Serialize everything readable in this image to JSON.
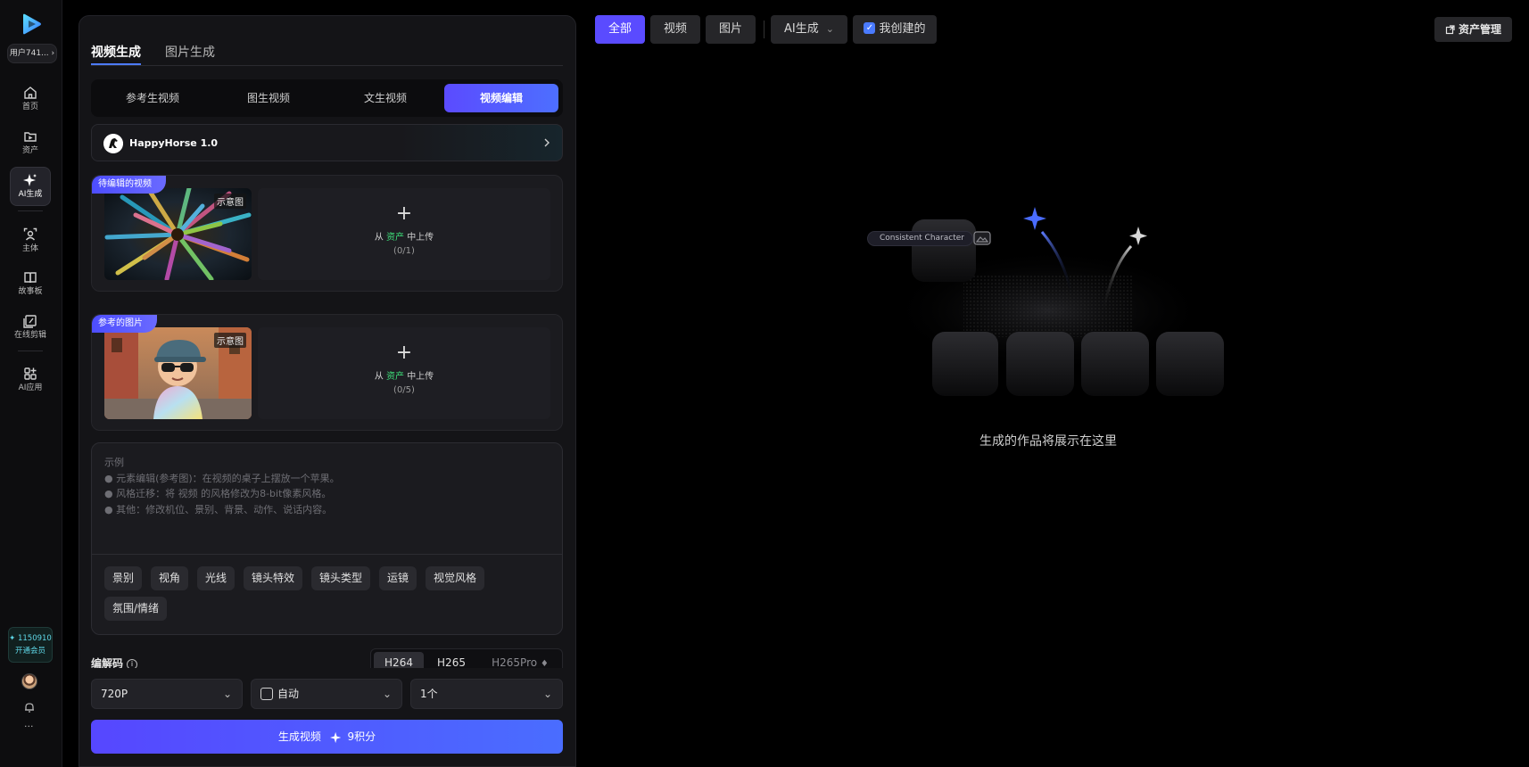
{
  "rail": {
    "user_label": "用户741...",
    "nav": [
      {
        "label": "首页",
        "icon": "home-icon"
      },
      {
        "label": "资产",
        "icon": "folder-icon"
      },
      {
        "label": "AI生成",
        "icon": "sparkle-icon"
      },
      {
        "label": "主体",
        "icon": "subject-icon"
      },
      {
        "label": "故事板",
        "icon": "storyboard-icon"
      },
      {
        "label": "在线剪辑",
        "icon": "edit-icon"
      },
      {
        "label": "AI应用",
        "icon": "apps-icon"
      }
    ],
    "credits": "✦ 1150910",
    "vip": "开通会员",
    "more": "···"
  },
  "panel": {
    "mode_tabs": [
      "视频生成",
      "图片生成"
    ],
    "sub_tabs": [
      "参考生视频",
      "图生视频",
      "文生视频",
      "视频编辑"
    ],
    "model_name": "HappyHorse 1.0",
    "video_card": {
      "tag": "待编辑的视频",
      "badge": "示意图",
      "plus": "+",
      "upload_prefix": "从",
      "upload_link": "资产",
      "upload_suffix": "中上传",
      "count": "(0/1)"
    },
    "image_card": {
      "tag": "参考的图片",
      "badge": "示意图",
      "plus": "+",
      "upload_prefix": "从",
      "upload_link": "资产",
      "upload_suffix": "中上传",
      "count": "(0/5)"
    },
    "prompt": {
      "lines": [
        "示例",
        "● 元素编辑(参考图)：在视频的桌子上摆放一个苹果。",
        "● 风格迁移：将 视频 的风格修改为8-bit像素风格。",
        "● 其他：修改机位、景别、背景、动作、说话内容。"
      ],
      "chips": [
        "景别",
        "视角",
        "光线",
        "镜头特效",
        "镜头类型",
        "运镜",
        "视觉风格",
        "氛围/情绪"
      ]
    },
    "codec": {
      "label": "编解码",
      "info": "i",
      "options": [
        "H264",
        "H265",
        "H265Pro"
      ]
    },
    "resolution": "720P",
    "duration": "自动",
    "quantity": "1个",
    "generate_label": "生成视频",
    "generate_cost": "9积分"
  },
  "top_filters": {
    "all": "全部",
    "video": "视频",
    "image": "图片",
    "ai_dropdown": "AI生成",
    "created_by_me": "我创建的",
    "asset_manage": "资产管理"
  },
  "empty_state": {
    "consistent_label": "Consistent Character",
    "message": "生成的作品将展示在这里"
  },
  "colors": {
    "accent": "#5a4bff",
    "green": "#3ee07a",
    "cyan": "#5fd8e8"
  }
}
